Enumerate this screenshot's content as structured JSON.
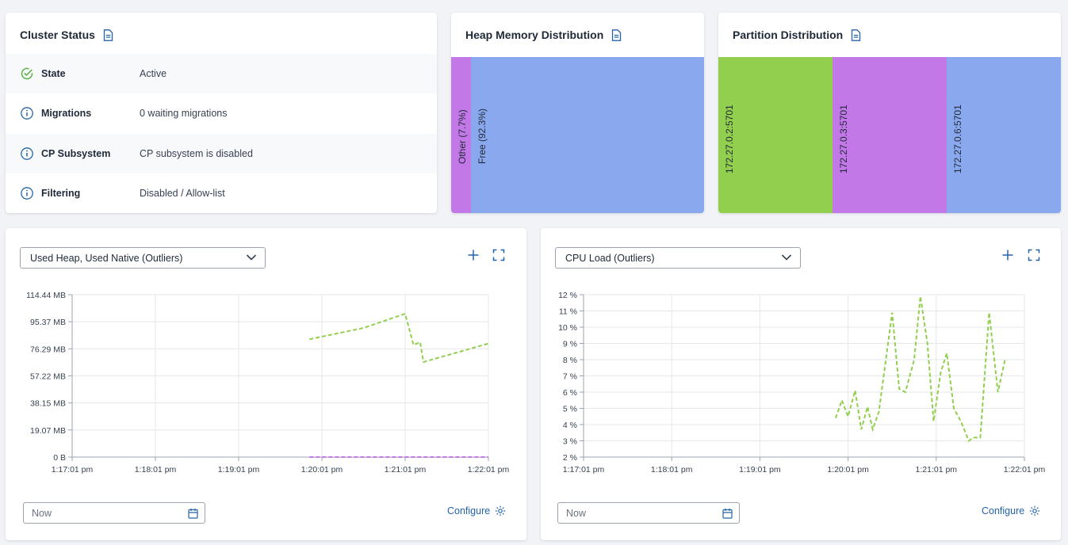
{
  "cluster_status": {
    "title": "Cluster Status",
    "rows": [
      {
        "label": "State",
        "value": "Active",
        "icon": "check-circle-icon"
      },
      {
        "label": "Migrations",
        "value": "0 waiting migrations",
        "icon": "info-icon"
      },
      {
        "label": "CP Subsystem",
        "value": "CP subsystem is disabled",
        "icon": "info-icon"
      },
      {
        "label": "Filtering",
        "value": "Disabled / Allow-list",
        "icon": "info-icon"
      }
    ]
  },
  "heap_memory": {
    "title": "Heap Memory Distribution",
    "segments": [
      {
        "label": "Other (7.7%)",
        "percent": 7.7,
        "color": "#c378e8"
      },
      {
        "label": "Free (92.3%)",
        "percent": 92.3,
        "color": "#8aa8ee"
      }
    ]
  },
  "partition": {
    "title": "Partition Distribution",
    "segments": [
      {
        "label": "172.27.0.2:5701",
        "percent": 33.3,
        "color": "#92cf4e"
      },
      {
        "label": "172.27.0.3:5701",
        "percent": 33.4,
        "color": "#c378e8"
      },
      {
        "label": "172.27.0.6:5701",
        "percent": 33.3,
        "color": "#8aa8ee"
      }
    ]
  },
  "left_panel": {
    "select_value": "Used Heap, Used Native (Outliers)",
    "date_value": "Now",
    "configure_label": "Configure"
  },
  "right_panel": {
    "select_value": "CPU Load (Outliers)",
    "date_value": "Now",
    "configure_label": "Configure"
  },
  "colors": {
    "green": "#92cf4e",
    "purple": "#c378e8",
    "blue": "#8aa8ee",
    "link": "#2563a8"
  },
  "chart_data": [
    {
      "type": "line",
      "ylim": [
        0,
        114.44
      ],
      "y_ticks": [
        "0 B",
        "19.07 MB",
        "38.15 MB",
        "57.22 MB",
        "76.29 MB",
        "95.37 MB",
        "114.44 MB"
      ],
      "x_ticks": [
        "1:17:01 pm",
        "1:18:01 pm",
        "1:19:01 pm",
        "1:20:01 pm",
        "1:21:01 pm",
        "1:22:01 pm"
      ],
      "grid": true,
      "series": [
        {
          "color": "#92cf4e",
          "dash": true,
          "points": [
            [
              2.85,
              83
            ],
            [
              3.5,
              91
            ],
            [
              4.0,
              101
            ],
            [
              4.1,
              79
            ],
            [
              4.18,
              81
            ],
            [
              4.22,
              67
            ],
            [
              5.0,
              80
            ]
          ]
        },
        {
          "color": "#c378e8",
          "dash": true,
          "points": [
            [
              2.85,
              0
            ],
            [
              5.0,
              0
            ]
          ]
        }
      ]
    },
    {
      "type": "line",
      "ylim": [
        2,
        12
      ],
      "y_ticks": [
        "2 %",
        "3 %",
        "4 %",
        "5 %",
        "6 %",
        "7 %",
        "8 %",
        "9 %",
        "10 %",
        "11 %",
        "12 %"
      ],
      "x_ticks": [
        "1:17:01 pm",
        "1:18:01 pm",
        "1:19:01 pm",
        "1:20:01 pm",
        "1:21:01 pm",
        "1:22:01 pm"
      ],
      "grid": true,
      "series": [
        {
          "color": "#92cf4e",
          "dash": true,
          "points": [
            [
              2.86,
              4.4
            ],
            [
              2.93,
              5.5
            ],
            [
              3.0,
              4.5
            ],
            [
              3.08,
              6.1
            ],
            [
              3.15,
              3.7
            ],
            [
              3.22,
              5.1
            ],
            [
              3.28,
              3.7
            ],
            [
              3.35,
              4.8
            ],
            [
              3.5,
              10.9
            ],
            [
              3.58,
              6.2
            ],
            [
              3.65,
              6.0
            ],
            [
              3.75,
              8.0
            ],
            [
              3.82,
              11.9
            ],
            [
              3.9,
              9.0
            ],
            [
              3.97,
              4.2
            ],
            [
              4.05,
              7.2
            ],
            [
              4.12,
              8.4
            ],
            [
              4.2,
              5.0
            ],
            [
              4.28,
              4.2
            ],
            [
              4.37,
              3.0
            ],
            [
              4.42,
              3.2
            ],
            [
              4.5,
              3.2
            ],
            [
              4.6,
              10.9
            ],
            [
              4.7,
              6.0
            ],
            [
              4.78,
              8.0
            ]
          ]
        }
      ]
    }
  ]
}
